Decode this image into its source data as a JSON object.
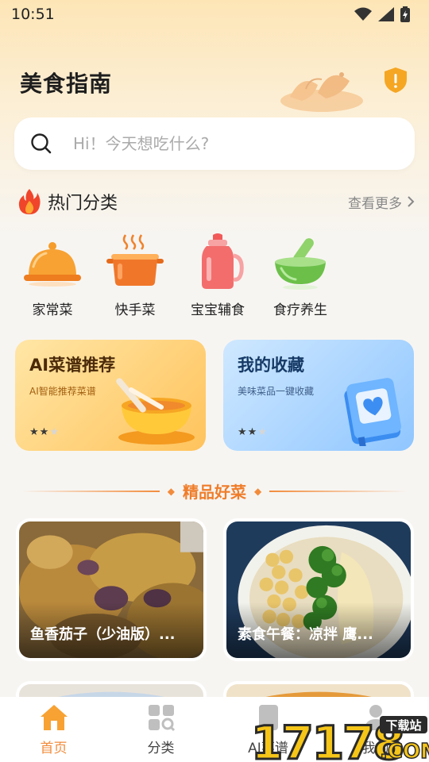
{
  "status_bar": {
    "time": "10:51"
  },
  "header": {
    "title": "美食指南"
  },
  "search": {
    "placeholder": "Hi！今天想吃什么?"
  },
  "hot_section": {
    "title": "热门分类",
    "more": "查看更多"
  },
  "categories": [
    {
      "label": "家常菜",
      "icon": "cloche-icon"
    },
    {
      "label": "快手菜",
      "icon": "pot-icon"
    },
    {
      "label": "宝宝辅食",
      "icon": "baby-bottle-icon"
    },
    {
      "label": "食疗养生",
      "icon": "mortar-icon"
    }
  ],
  "cards": [
    {
      "title": "AI菜谱推荐",
      "subtitle": "AI智能推荐菜谱",
      "stars": 2
    },
    {
      "title": "我的收藏",
      "subtitle": "美味菜品一键收藏",
      "stars": 2
    }
  ],
  "featured": {
    "title": "精品好菜"
  },
  "dishes": [
    {
      "name": "鱼香茄子（少油版）..."
    },
    {
      "name": "素食午餐：凉拌 鹰..."
    }
  ],
  "tabs": [
    {
      "label": "首页",
      "active": true
    },
    {
      "label": "分类",
      "active": false
    },
    {
      "label": "AI菜谱",
      "active": false
    },
    {
      "label": "我的",
      "active": false
    }
  ],
  "watermark": {
    "text": "17178",
    "sub": ".COM",
    "badge": "下载站"
  },
  "colors": {
    "accent": "#f28c3c",
    "ai_card": "#ffc35c",
    "fav_card": "#8fc6ff"
  }
}
